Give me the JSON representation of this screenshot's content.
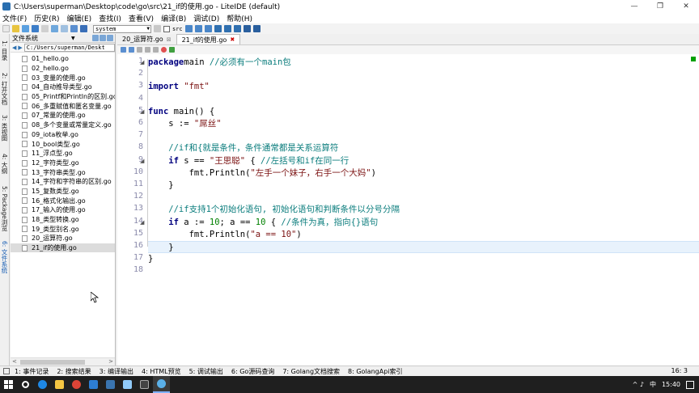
{
  "window": {
    "title": "C:\\Users\\superman\\Desktop\\code\\go\\src\\21_if的使用.go - LiteIDE (default)",
    "buttons": [
      "—",
      "❐",
      "✕"
    ]
  },
  "menu": [
    "文件(F)",
    "历史(R)",
    "编辑(E)",
    "查找(I)",
    "查看(V)",
    "编译(B)",
    "调试(D)",
    "帮助(H)"
  ],
  "toolbar": {
    "env_select": "system",
    "src_label": "src"
  },
  "side_tabs": [
    "1: 目录",
    "2: 打开文档",
    "3: 类视图",
    "4: 大纲",
    "5: Package浏览",
    "6: 文件系统"
  ],
  "panel": {
    "title": "文件系统",
    "path": "C:/Users/superman/Deskt",
    "files": [
      "01_hello.go",
      "02_hello.go",
      "03_变量的使用.go",
      "04_自动推导类型.go",
      "05_Printf和Println的区别.go",
      "06_多重赋值和匿名变量.go",
      "07_常量的使用.go",
      "08_多个变量或常量定义.go",
      "09_iota枚举.go",
      "10_bool类型.go",
      "11_浮点型.go",
      "12_字符类型.go",
      "13_字符串类型.go",
      "14_字符和字符串的区别.go",
      "15_复数类型.go",
      "16_格式化输出.go",
      "17_输入的使用.go",
      "18_类型转换.go",
      "19_类型别名.go",
      "20_运算符.go",
      "21_if的使用.go"
    ],
    "selected_index": 20
  },
  "tabs": [
    {
      "label": "20_运算符.go",
      "active": false
    },
    {
      "label": "21_if的使用.go",
      "active": true
    }
  ],
  "editor": {
    "current_line": 16,
    "lines": [
      {
        "n": "1",
        "parts": [
          [
            "kw",
            "package"
          ],
          [
            "",
            "main "
          ],
          [
            "cm",
            "//必须有一个main包"
          ]
        ]
      },
      {
        "n": "2",
        "parts": []
      },
      {
        "n": "3",
        "parts": [
          [
            "kw",
            "import"
          ],
          [
            "",
            ""
          ],
          [
            "str",
            " \"fmt\""
          ]
        ]
      },
      {
        "n": "4",
        "parts": []
      },
      {
        "n": "5",
        "parts": [
          [
            "kw",
            "func"
          ],
          [
            "",
            " main() {"
          ]
        ]
      },
      {
        "n": "6",
        "parts": [
          [
            "",
            "    s := "
          ],
          [
            "str",
            "\"屌丝\""
          ]
        ]
      },
      {
        "n": "7",
        "parts": []
      },
      {
        "n": "8",
        "parts": [
          [
            "cm",
            "    //if和{就是条件，条件通常都是关系运算符"
          ]
        ]
      },
      {
        "n": "9",
        "parts": [
          [
            "kw",
            "    if"
          ],
          [
            "",
            " s == "
          ],
          [
            "str",
            "\"王思聪\""
          ],
          [
            "",
            " { "
          ],
          [
            "cm",
            "//左括号和if在同一行"
          ]
        ]
      },
      {
        "n": "10",
        "parts": [
          [
            "",
            "        fmt.Println("
          ],
          [
            "str",
            "\"左手一个妹子，右手一个大妈\""
          ],
          [
            "",
            ")"
          ]
        ]
      },
      {
        "n": "11",
        "parts": [
          [
            "",
            "    }"
          ]
        ]
      },
      {
        "n": "12",
        "parts": []
      },
      {
        "n": "13",
        "parts": [
          [
            "cm",
            "    //if支持1个初始化语句, 初始化语句和判断条件以分号分隔"
          ]
        ]
      },
      {
        "n": "14",
        "parts": [
          [
            "kw",
            "    if"
          ],
          [
            "",
            " a := "
          ],
          [
            "num",
            "10"
          ],
          [
            "",
            "; a == "
          ],
          [
            "num",
            "10"
          ],
          [
            "",
            " { "
          ],
          [
            "cm",
            "//条件为真，指向{}语句"
          ]
        ]
      },
      {
        "n": "15",
        "parts": [
          [
            "",
            "        fmt.Println("
          ],
          [
            "str",
            "\"a == 10\""
          ],
          [
            "",
            ")"
          ]
        ]
      },
      {
        "n": "16",
        "parts": [
          [
            "",
            "    }"
          ]
        ]
      },
      {
        "n": "17",
        "parts": [
          [
            "",
            "}"
          ]
        ]
      },
      {
        "n": "18",
        "parts": []
      }
    ]
  },
  "bottom_tabs": [
    "1: 事件记录",
    "2: 搜索结果",
    "3: 编译输出",
    "4: HTML预览",
    "5: 调试输出",
    "6: Go源码查询",
    "7: Golang文档搜索",
    "8: GolangApi索引"
  ],
  "cursor_pos": "16: 3",
  "taskbar": {
    "time": "15:40",
    "ime": "中",
    "tray_misc": "^ ♪"
  },
  "colors": {
    "keyword": "#00007f",
    "string": "#7a1010",
    "comment": "#0b7d7d",
    "number": "#008000",
    "current_line": "#e8f2fc"
  }
}
